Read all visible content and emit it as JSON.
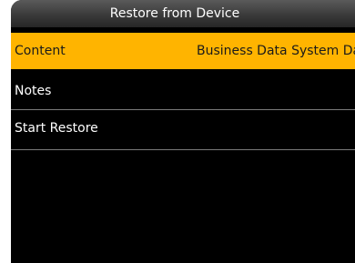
{
  "header": {
    "title": "Restore from Device"
  },
  "menu": {
    "items": [
      {
        "label": "Content",
        "value": "Business Data System Dat"
      },
      {
        "label": "Notes",
        "value": ""
      },
      {
        "label": "Start Restore",
        "value": ""
      }
    ],
    "selected_index": 0
  },
  "colors": {
    "highlight": "#ffb400",
    "background": "#000000",
    "text": "#ffffff"
  }
}
